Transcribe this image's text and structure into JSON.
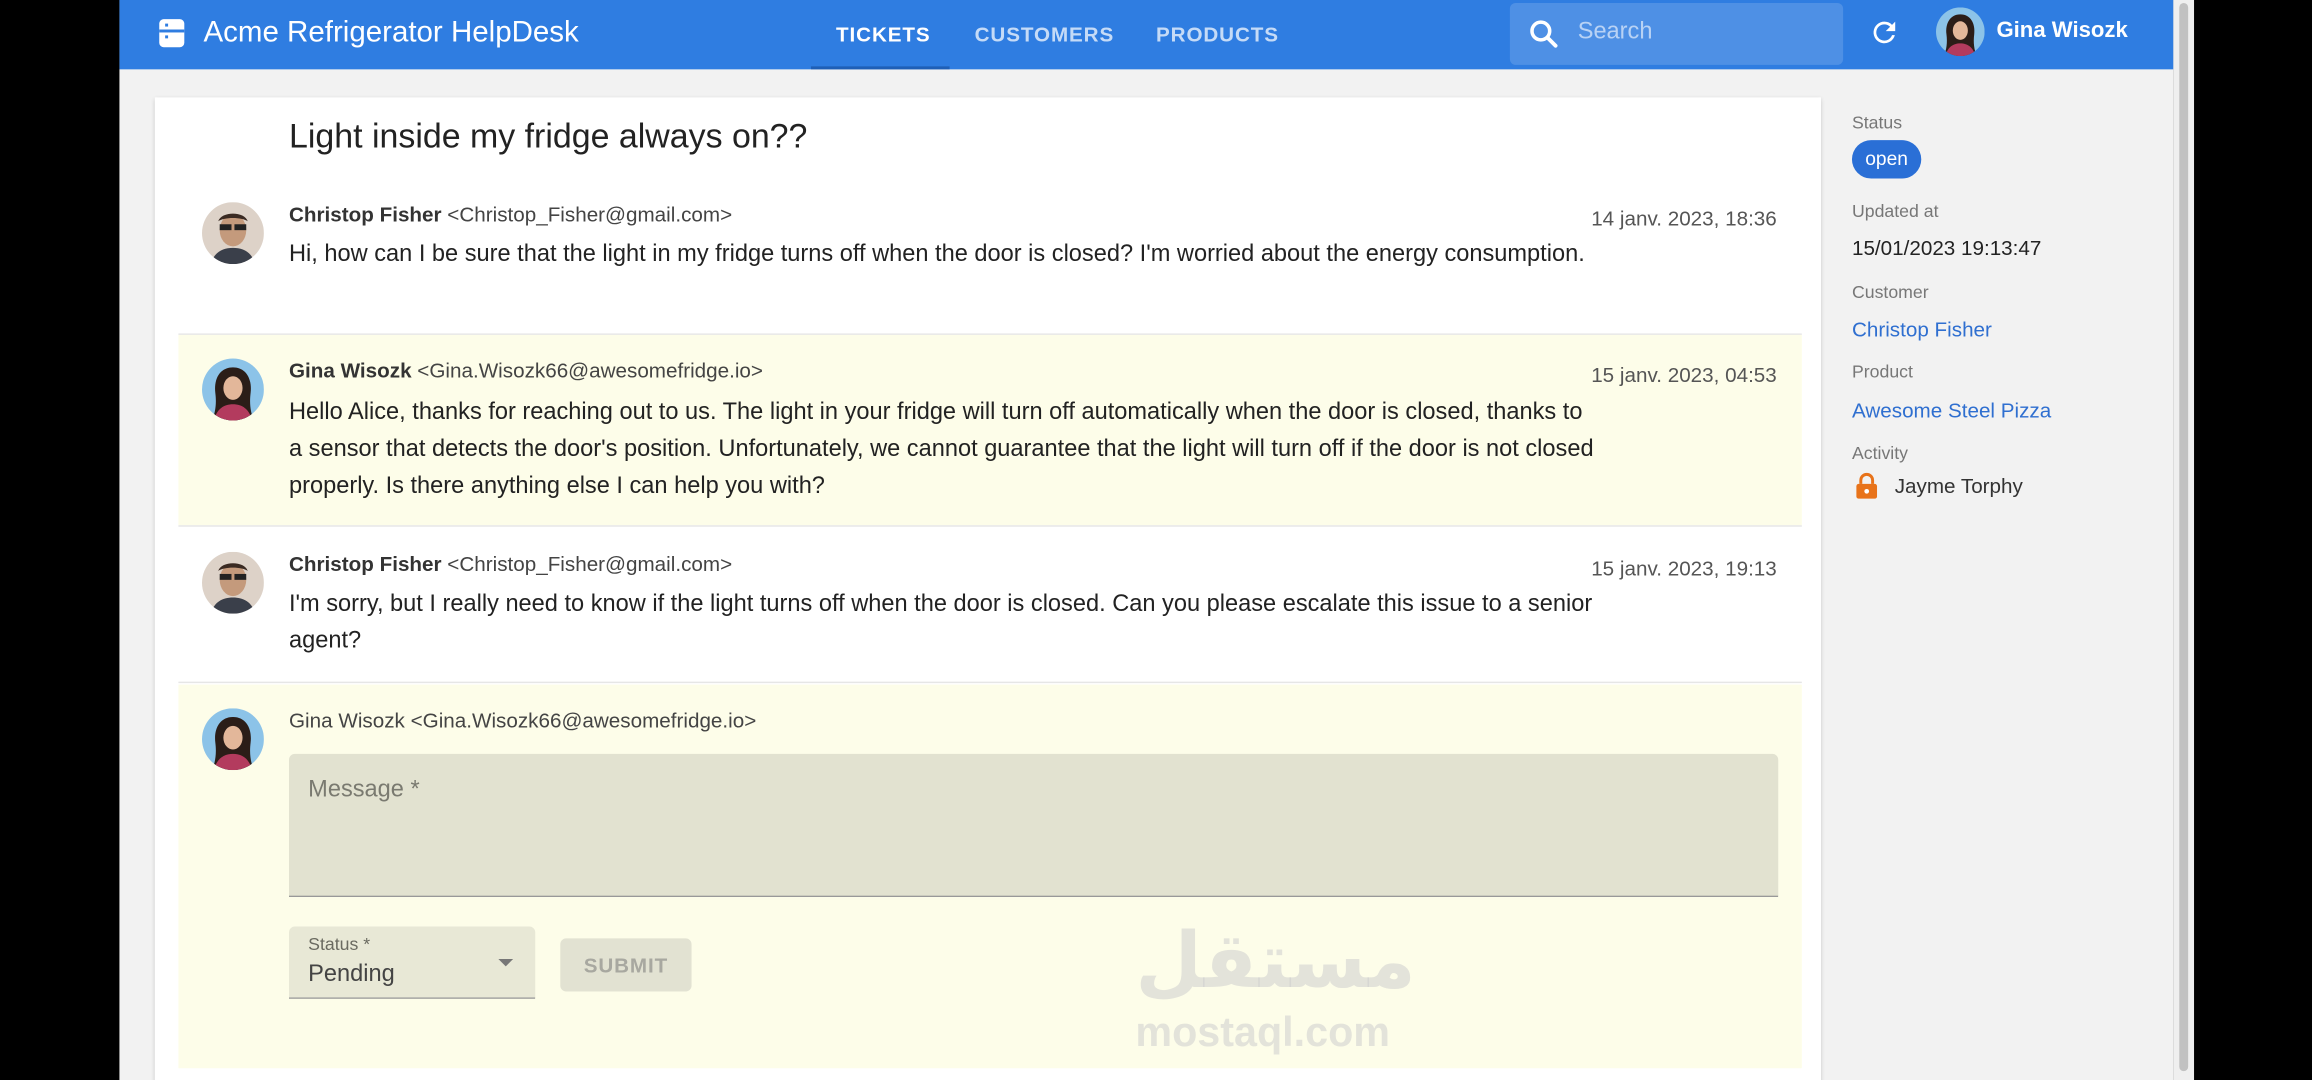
{
  "app": {
    "title": "Acme Refrigerator HelpDesk"
  },
  "nav": {
    "tabs": [
      "TICKETS",
      "CUSTOMERS",
      "PRODUCTS"
    ],
    "active": "TICKETS"
  },
  "search": {
    "placeholder": "Search"
  },
  "user": {
    "name": "Gina Wisozk"
  },
  "ticket": {
    "title": "Light inside my fridge always on??",
    "messages": [
      {
        "author": "Christop Fisher",
        "email": "<Christop_Fisher@gmail.com>",
        "date": "14 janv. 2023, 18:36",
        "body": "Hi, how can I be sure that the light in my fridge turns off when the door is closed? I'm worried about the energy consumption."
      },
      {
        "author": "Gina Wisozk",
        "email": "<Gina.Wisozk66@awesomefridge.io>",
        "date": "15 janv. 2023, 04:53",
        "body": "Hello Alice, thanks for reaching out to us. The light in your fridge will turn off automatically when the door is closed, thanks to a sensor that detects the door's position. Unfortunately, we cannot guarantee that the light will turn off if the door is not closed properly. Is there anything else I can help you with?"
      },
      {
        "author": "Christop Fisher",
        "email": "<Christop_Fisher@gmail.com>",
        "date": "15 janv. 2023, 19:13",
        "body": "I'm sorry, but I really need to know if the light turns off when the door is closed. Can you please escalate this issue to a senior agent?"
      }
    ]
  },
  "reply": {
    "author": "Gina Wisozk <Gina.Wisozk66@awesomefridge.io>",
    "message_label": "Message *",
    "status_label": "Status *",
    "status_value": "Pending",
    "submit_label": "SUBMIT"
  },
  "sidebar": {
    "status_label": "Status",
    "status_value": "open",
    "updated_label": "Updated at",
    "updated_value": "15/01/2023 19:13:47",
    "customer_label": "Customer",
    "customer_value": "Christop Fisher",
    "product_label": "Product",
    "product_value": "Awesome Steel Pizza",
    "activity_label": "Activity",
    "activity_value": "Jayme Torphy"
  },
  "watermark": {
    "arabic": "مستقل",
    "url": "mostaql.com"
  },
  "colors": {
    "appbar": "#2f7de1",
    "agent_bg": "#fdfde9",
    "chip": "#2a6fd6",
    "link": "#2f6fd0",
    "lock": "#e8731a"
  }
}
